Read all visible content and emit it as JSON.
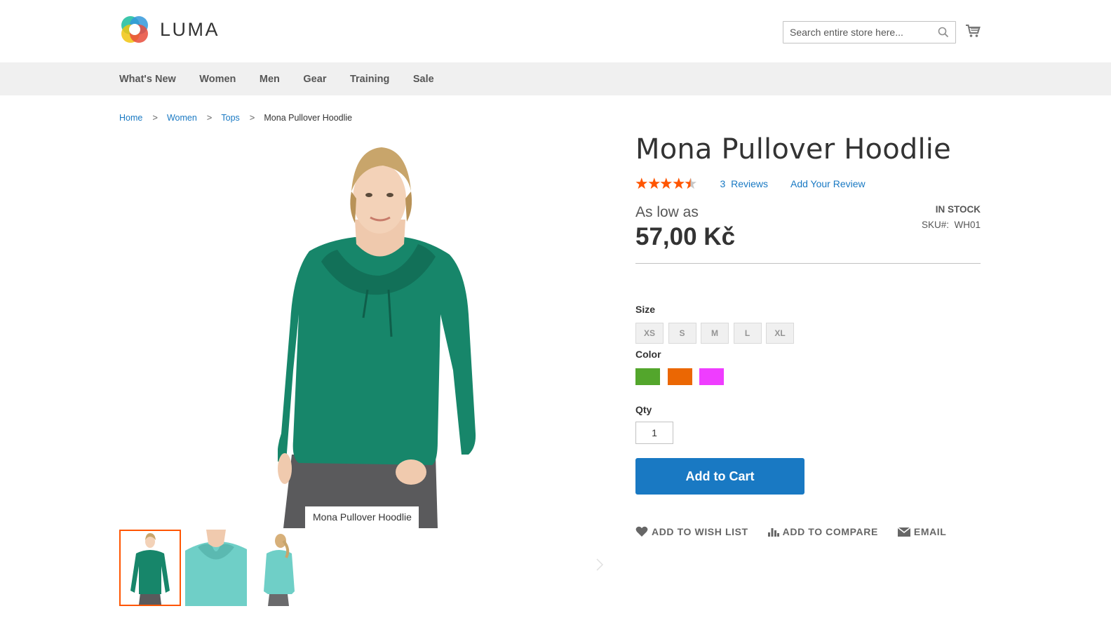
{
  "header": {
    "logo_text": "LUMA",
    "search_placeholder": "Search entire store here..."
  },
  "nav": {
    "items": [
      {
        "label": "What's New"
      },
      {
        "label": "Women"
      },
      {
        "label": "Men"
      },
      {
        "label": "Gear"
      },
      {
        "label": "Training"
      },
      {
        "label": "Sale"
      }
    ]
  },
  "breadcrumb": {
    "items": [
      "Home",
      "Women",
      "Tops"
    ],
    "separator": ">",
    "current": "Mona Pullover Hoodlie"
  },
  "gallery": {
    "caption": "Mona Pullover Hoodlie",
    "shirt_color": "#17866a"
  },
  "product": {
    "title": "Mona Pullover Hoodlie",
    "rating_fraction": 0.9,
    "reviews_count": "3",
    "reviews_label": "Reviews",
    "add_review": "Add Your Review",
    "as_low_as": "As low as",
    "price": "57,00 Kč",
    "stock": "IN STOCK",
    "sku_label": "SKU#:",
    "sku_value": "WH01"
  },
  "options": {
    "size_label": "Size",
    "sizes": [
      "XS",
      "S",
      "M",
      "L",
      "XL"
    ],
    "color_label": "Color",
    "colors": [
      "#53a62c",
      "#eb6703",
      "#ef3dff"
    ],
    "qty_label": "Qty",
    "qty_value": "1"
  },
  "buttons": {
    "add_to_cart": "Add to Cart"
  },
  "actions": {
    "wishlist": "ADD TO WISH LIST",
    "compare": "ADD TO COMPARE",
    "email": "EMAIL"
  },
  "colors": {
    "accent": "#1979c3",
    "star": "#ff5501",
    "nav_bg": "#f0f0f0"
  }
}
